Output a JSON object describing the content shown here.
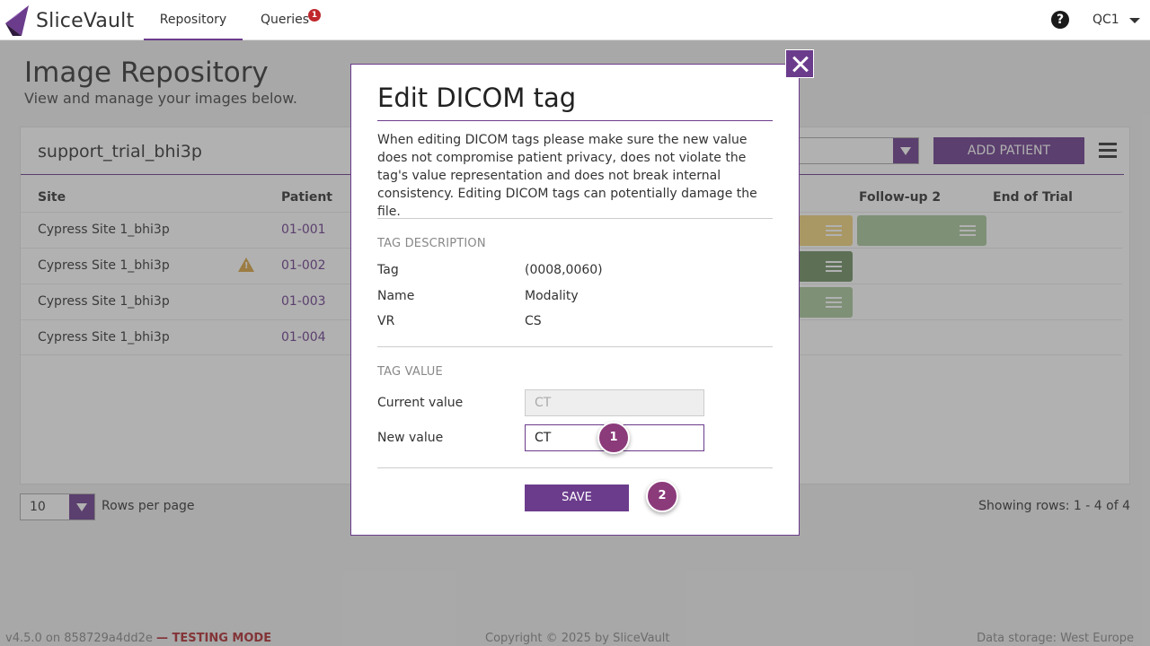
{
  "app": {
    "name": "SliceVault"
  },
  "nav": {
    "tabs": [
      {
        "label": "Repository",
        "active": true
      },
      {
        "label": "Queries",
        "badge": "1"
      }
    ],
    "help_icon": "?",
    "user": "QC1"
  },
  "page": {
    "title": "Image Repository",
    "subtitle": "View and manage your images below."
  },
  "card": {
    "trial_name": "support_trial_bhi3p",
    "add_patient_label": "ADD PATIENT",
    "columns": [
      "Site",
      "Patient",
      "Follow-up 2",
      "End of Trial"
    ],
    "rows": [
      {
        "site": "Cypress Site 1_bhi3p",
        "patient": "01-001",
        "warning": false
      },
      {
        "site": "Cypress Site 1_bhi3p",
        "patient": "01-002",
        "warning": true
      },
      {
        "site": "Cypress Site 1_bhi3p",
        "patient": "01-003",
        "warning": false
      },
      {
        "site": "Cypress Site 1_bhi3p",
        "patient": "01-004",
        "warning": false
      }
    ]
  },
  "pagination": {
    "rows_per_page_value": "10",
    "rows_per_page_label": "Rows per page",
    "showing": "Showing rows: 1 - 4 of 4"
  },
  "footer": {
    "version": "v4.5.0 on 858729a4dd2e",
    "testing": "— TESTING MODE",
    "copyright": "Copyright © 2025 by SliceVault",
    "storage": "Data storage: West Europe"
  },
  "modal": {
    "title": "Edit DICOM tag",
    "description": "When editing DICOM tags please make sure the new value does not compromise patient privacy, does not violate the tag's value representation and does not break internal consistency. Editing DICOM tags can potentially damage the file.",
    "tag_description_label": "TAG DESCRIPTION",
    "tag_key": "Tag",
    "tag_value": "(0008,0060)",
    "name_key": "Name",
    "name_value": "Modality",
    "vr_key": "VR",
    "vr_value": "CS",
    "tag_value_label": "TAG VALUE",
    "current_value_label": "Current value",
    "current_value": "CT",
    "new_value_label": "New value",
    "new_value": "CT",
    "save_label": "SAVE",
    "step1": "1",
    "step2": "2"
  },
  "colors": {
    "accent": "#6b3c8c",
    "step_marker": "#8b3a7a",
    "warning": "#d9a441",
    "chip_yellow": "#f2d37a",
    "chip_green": "#a8c79a",
    "chip_dark_green": "#6f8f62",
    "testing_mode": "#b0282d"
  }
}
